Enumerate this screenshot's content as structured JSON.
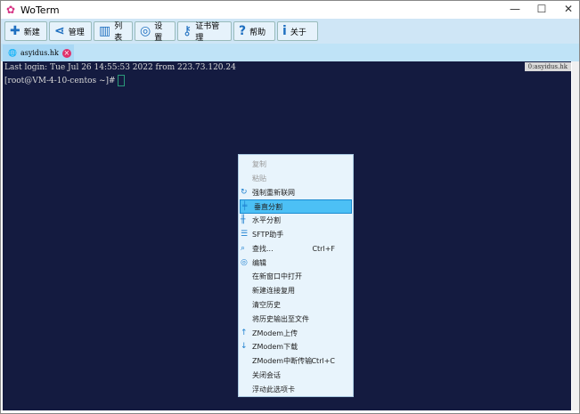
{
  "window": {
    "title": "WoTerm",
    "minimize": "—",
    "maximize": "☐",
    "close": "✕"
  },
  "toolbar": [
    {
      "icon": "plus-icon",
      "glyph": "✚",
      "label": "新建"
    },
    {
      "icon": "share-icon",
      "glyph": "⋖",
      "label": "管理"
    },
    {
      "icon": "list-icon",
      "glyph": "▥",
      "label": "列表"
    },
    {
      "icon": "palette-icon",
      "glyph": "◎",
      "label": "设置"
    },
    {
      "icon": "key-icon",
      "glyph": "⚷",
      "label": "证书管理"
    },
    {
      "icon": "help-icon",
      "glyph": "?",
      "label": "帮助"
    },
    {
      "icon": "info-icon",
      "glyph": "i",
      "label": "关于"
    }
  ],
  "tab": {
    "label": "asyidus.hk",
    "close": "×"
  },
  "terminal": {
    "line1": "Last login: Tue Jul 26 14:55:53 2022 from 223.73.120.24",
    "prompt": "[root@VM-4-10-centos ~]# ",
    "badge": "0:asyidus.hk"
  },
  "menu": [
    {
      "label": "复制",
      "disabled": true
    },
    {
      "label": "粘贴",
      "disabled": true
    },
    {
      "label": "强制重新联网",
      "icon": "reconnect-icon",
      "glyph": "↻"
    },
    {
      "label": "垂直分割",
      "icon": "vertical-split-icon",
      "glyph": "╪",
      "selected": true
    },
    {
      "label": "水平分割",
      "icon": "horizontal-split-icon",
      "glyph": "╫"
    },
    {
      "label": "SFTP助手",
      "icon": "sftp-icon",
      "glyph": "☰"
    },
    {
      "label": "查找...",
      "icon": "find-icon",
      "glyph": "⌕",
      "shortcut": "Ctrl+F"
    },
    {
      "label": "编辑",
      "icon": "palette-icon",
      "glyph": "◎"
    },
    {
      "label": "在新窗口中打开"
    },
    {
      "label": "新建连接复用"
    },
    {
      "label": "清空历史"
    },
    {
      "label": "将历史输出至文件"
    },
    {
      "label": "ZModem上传",
      "icon": "upload-arrow-icon",
      "glyph": "↑"
    },
    {
      "label": "ZModem下载",
      "icon": "download-arrow-icon",
      "glyph": "↓"
    },
    {
      "label": "ZModem中断传输",
      "shortcut": "Ctrl+C"
    },
    {
      "label": "关闭会话"
    },
    {
      "label": "浮动此选项卡"
    }
  ]
}
